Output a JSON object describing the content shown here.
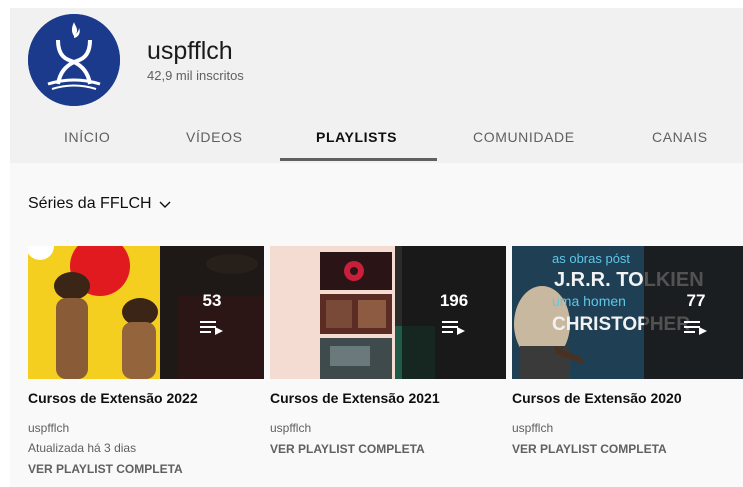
{
  "channel": {
    "name": "uspfflch",
    "subscribers": "42,9 mil inscritos"
  },
  "tabs": [
    {
      "label": "INÍCIO",
      "active": false
    },
    {
      "label": "VÍDEOS",
      "active": false
    },
    {
      "label": "PLAYLISTS",
      "active": true
    },
    {
      "label": "COMUNIDADE",
      "active": false
    },
    {
      "label": "CANAIS",
      "active": false
    }
  ],
  "section": {
    "title": "Séries da FFLCH",
    "icon": "chevron-down-icon"
  },
  "playlists": [
    {
      "title": "Cursos de Extensão 2022",
      "count": "53",
      "channel": "uspfflch",
      "updated": "Atualizada há 3 dias",
      "link": "VER PLAYLIST COMPLETA"
    },
    {
      "title": "Cursos de Extensão 2021",
      "count": "196",
      "channel": "uspfflch",
      "link": "VER PLAYLIST COMPLETA"
    },
    {
      "title": "Cursos de Extensão 2020",
      "count": "77",
      "channel": "uspfflch",
      "link": "VER PLAYLIST COMPLETA",
      "thumb_text": [
        "as obras póst",
        "J.R.R. TOLKIEN",
        "uma homen",
        "CHRISTOPHER"
      ]
    }
  ],
  "colors": {
    "avatar_bg": "#1c3a8c",
    "header_bg": "#f1f1f1",
    "content_bg": "#f9f9f9",
    "muted_text": "#606060"
  }
}
